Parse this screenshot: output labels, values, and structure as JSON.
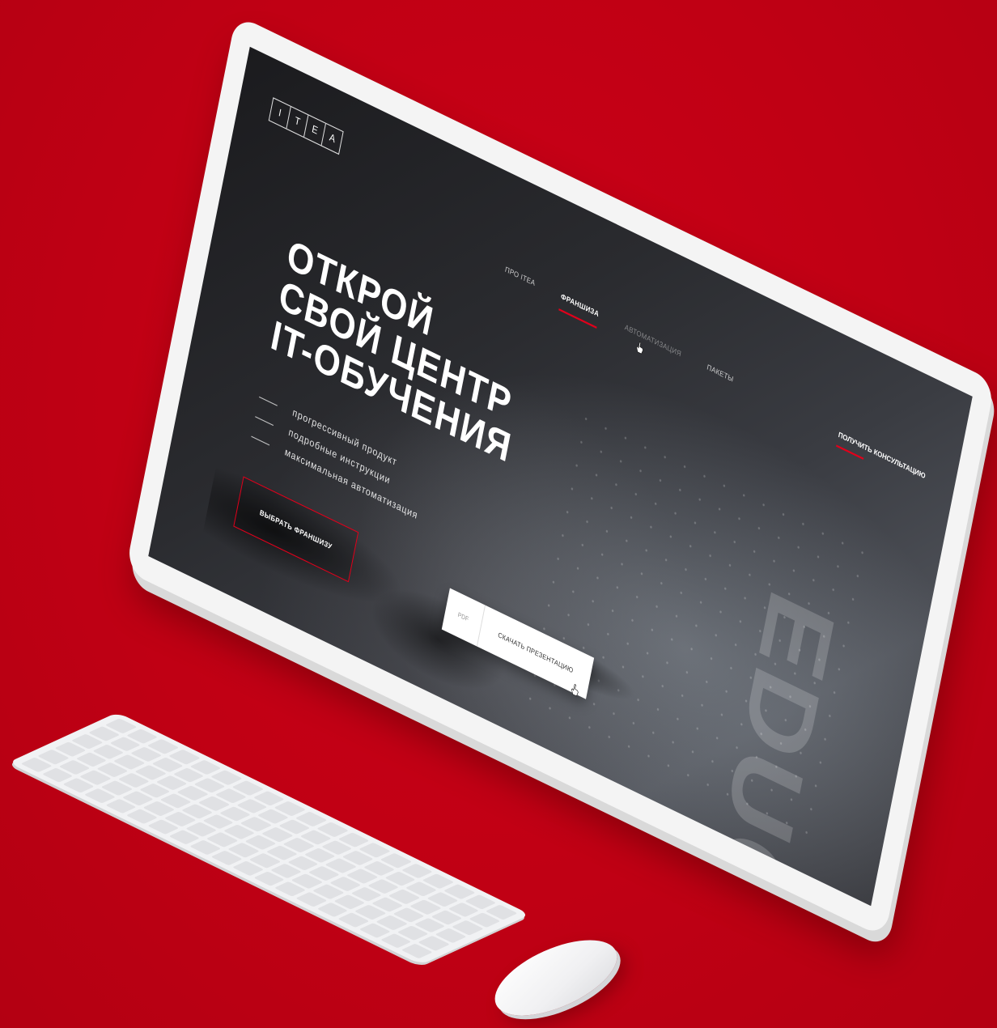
{
  "colors": {
    "background": "#c10014",
    "accent": "#e0001b",
    "monitor_frame": "#f4f4f4",
    "screen_dark": "#1b1b1e"
  },
  "site": {
    "logo_letters": [
      "I",
      "T",
      "E",
      "A"
    ],
    "nav": [
      {
        "label": "ПРО ITEA",
        "state": "normal"
      },
      {
        "label": "ФРАНШИЗА",
        "state": "active"
      },
      {
        "label": "АВТОМАТИЗАЦИЯ",
        "state": "hover"
      },
      {
        "label": "ПАКЕТЫ",
        "state": "normal"
      }
    ],
    "consult_label": "ПОЛУЧИТЬ КОНСУЛЬТАЦИЮ",
    "headline": [
      "ОТКРОЙ",
      "СВОЙ ЦЕНТР",
      "IT-ОБУЧЕНИЯ"
    ],
    "features": [
      "прогрессивный продукт",
      "подробные инструкции",
      "максимальная автоматизация"
    ],
    "cta_franchise": "ВЫБРАТЬ ФРАНШИЗУ",
    "download": {
      "format": "PDF",
      "label": "СКАЧАТЬ ПРЕЗЕНТАЦИЮ"
    },
    "background_word": "EDUC"
  },
  "icons": {
    "hover_cursor": "hand-pointer-icon",
    "click_cursor": "hand-pointer-icon"
  }
}
